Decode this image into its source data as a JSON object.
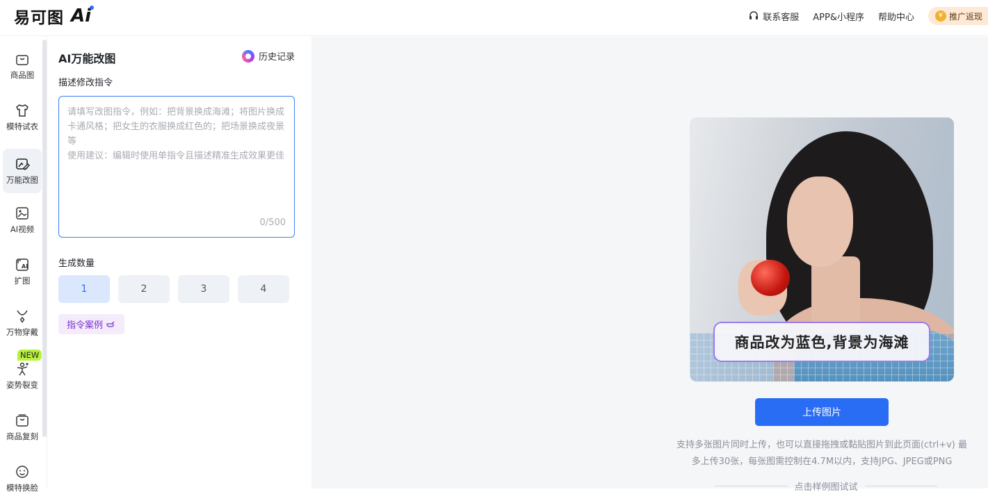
{
  "header": {
    "logo_text": "易可图",
    "logo_ai": "Ai",
    "nav": [
      {
        "label": "联系客服",
        "icon": "headset-icon"
      },
      {
        "label": "APP&小程序"
      },
      {
        "label": "帮助中心"
      }
    ],
    "promo_label": "推广返现"
  },
  "rail": {
    "items": [
      {
        "label": "商品图",
        "icon": "bag-icon"
      },
      {
        "label": "模特试衣",
        "icon": "shirt-icon"
      },
      {
        "label": "万能改图",
        "icon": "edit-image-icon",
        "active": true
      },
      {
        "label": "AI视频",
        "icon": "video-icon"
      },
      {
        "label": "扩图",
        "icon": "expand-icon"
      },
      {
        "label": "万物穿戴",
        "icon": "necklace-icon"
      },
      {
        "label": "姿势裂变",
        "icon": "pose-icon"
      },
      {
        "label": "商品复刻",
        "icon": "copy-bag-icon"
      },
      {
        "label": "模特换脸",
        "icon": "face-icon"
      }
    ],
    "new_badge": "NEW"
  },
  "panel": {
    "title": "AI万能改图",
    "history_label": "历史记录",
    "prompt_label": "描述修改指令",
    "prompt_value": "",
    "prompt_placeholder": "请填写改图指令，例如：把背景换成海滩；将图片换成卡通风格；把女生的衣服换成红色的；把场景换成夜景等\n使用建议：编辑时使用单指令且描述精准生成效果更佳",
    "counter": "0/500",
    "quantity_label": "生成数量",
    "quantities": [
      "1",
      "2",
      "3",
      "4"
    ],
    "selected_quantity": "1",
    "example_label": "指令案例"
  },
  "main": {
    "preview_caption": "商品改为蓝色,背景为海滩",
    "upload_label": "上传图片",
    "hint_line1": "支持多张图片同时上传，也可以直接拖拽或黏贴图片到此页面(ctrl+v) 最",
    "hint_line2": "多上传30张，每张图需控制在4.7M以内，支持JPG、JPEG或PNG",
    "sample_label": "点击样例图试试"
  },
  "colors": {
    "accent": "#2a6df5",
    "active_bg": "#dbe7fd",
    "new_badge": "#b7f23c",
    "example_text": "#7b2fd0"
  }
}
